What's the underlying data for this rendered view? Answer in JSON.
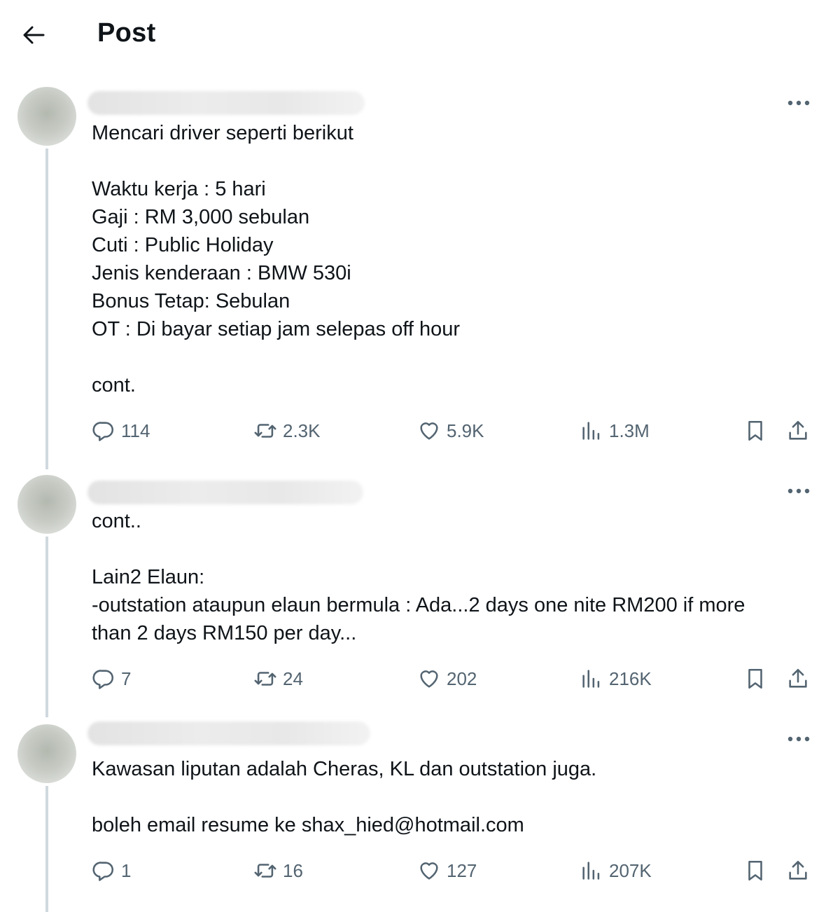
{
  "header": {
    "title": "Post"
  },
  "posts": [
    {
      "text": "Mencari driver seperti berikut\n\nWaktu kerja : 5 hari\nGaji : RM 3,000 sebulan\nCuti : Public Holiday\nJenis kenderaan : BMW 530i\nBonus Tetap: Sebulan\nOT : Di bayar setiap jam selepas off hour\n\ncont.",
      "replies": "114",
      "reposts": "2.3K",
      "likes": "5.9K",
      "views": "1.3M"
    },
    {
      "text": "cont..\n\nLain2 Elaun:\n-outstation ataupun elaun bermula : Ada...2 days one nite RM200 if more\nthan 2 days RM150 per day...",
      "replies": "7",
      "reposts": "24",
      "likes": "202",
      "views": "216K"
    },
    {
      "text": "Kawasan liputan adalah Cheras, KL dan outstation juga.\n\nboleh email resume ke shax_hied@hotmail.com",
      "replies": "1",
      "reposts": "16",
      "likes": "127",
      "views": "207K"
    }
  ],
  "icons": {
    "back": "arrow-left-icon",
    "more": "more-icon",
    "reply": "reply-icon",
    "repost": "repost-icon",
    "like": "heart-icon",
    "views": "views-icon",
    "bookmark": "bookmark-icon",
    "share": "share-icon"
  },
  "colors": {
    "text": "#0f1419",
    "secondary": "#536471",
    "thread_line": "#cfd9de"
  }
}
